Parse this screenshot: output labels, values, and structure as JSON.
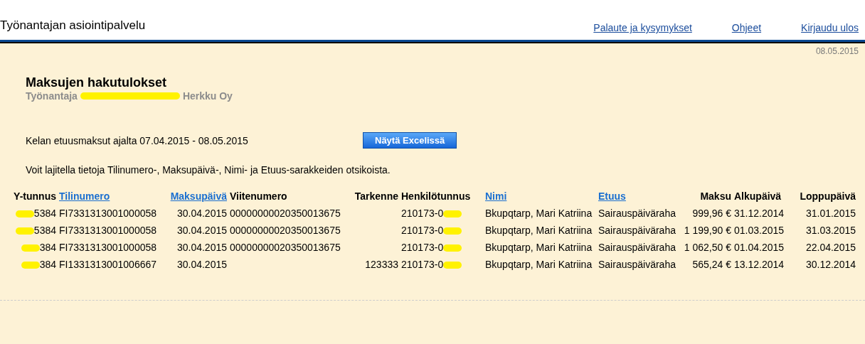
{
  "header": {
    "title": "Työnantajan asiointipalvelu",
    "links": [
      "Palaute ja kysymykset",
      "Ohjeet",
      "Kirjaudu ulos"
    ]
  },
  "date": "08.05.2015",
  "heading": "Maksujen hakutulokset",
  "employer": {
    "prefix": "Työnantaja",
    "suffix": "Herkku Oy"
  },
  "period": "Kelan etuusmaksut ajalta 07.04.2015 - 08.05.2015",
  "excel_button": "Näytä Excelissä",
  "hint": "Voit lajitella tietoja Tilinumero-, Maksupäivä-, Nimi- ja Etuus-sarakkeiden otsikoista.",
  "table": {
    "columns": [
      {
        "label": "Y-tunnus",
        "sortable": false
      },
      {
        "label": "Tilinumero",
        "sortable": true
      },
      {
        "label": "Maksupäivä",
        "sortable": true
      },
      {
        "label": "Viitenumero",
        "sortable": false
      },
      {
        "label": "Tarkenne",
        "sortable": false
      },
      {
        "label": "Henkilötunnus",
        "sortable": false
      },
      {
        "label": "Nimi",
        "sortable": true
      },
      {
        "label": "Etuus",
        "sortable": true
      },
      {
        "label": "Maksu",
        "sortable": false
      },
      {
        "label": "Alkupäivä",
        "sortable": false
      },
      {
        "label": "Loppupäivä",
        "sortable": false
      }
    ],
    "rows": [
      {
        "cells": [
          {
            "text": "5384",
            "redacted_before": true
          },
          "FI7331313001000058",
          "30.04.2015",
          "00000000020350013675",
          "",
          {
            "text": "210173-0",
            "redacted_after": true
          },
          "Bkupqtarp, Mari Katriina",
          "Sairauspäiväraha",
          "999,96 €",
          "31.12.2014",
          "31.01.2015"
        ]
      },
      {
        "cells": [
          {
            "text": "5384",
            "redacted_before": true
          },
          "FI7331313001000058",
          "30.04.2015",
          "00000000020350013675",
          "",
          {
            "text": "210173-0",
            "redacted_after": true
          },
          "Bkupqtarp, Mari Katriina",
          "Sairauspäiväraha",
          "1 199,90 €",
          "01.03.2015",
          "31.03.2015"
        ]
      },
      {
        "cells": [
          {
            "text": "384",
            "redacted_before": true
          },
          "FI7331313001000058",
          "30.04.2015",
          "00000000020350013675",
          "",
          {
            "text": "210173-0",
            "redacted_after": true
          },
          "Bkupqtarp, Mari Katriina",
          "Sairauspäiväraha",
          "1 062,50 €",
          "01.04.2015",
          "22.04.2015"
        ]
      },
      {
        "cells": [
          {
            "text": "384",
            "redacted_before": true
          },
          "FI1331313001006667",
          "30.04.2015",
          "",
          "123333",
          {
            "text": "210173-0",
            "redacted_after": true
          },
          "Bkupqtarp, Mari Katriina",
          "Sairauspäiväraha",
          "565,24 €",
          "13.12.2014",
          "30.12.2014"
        ]
      }
    ]
  }
}
